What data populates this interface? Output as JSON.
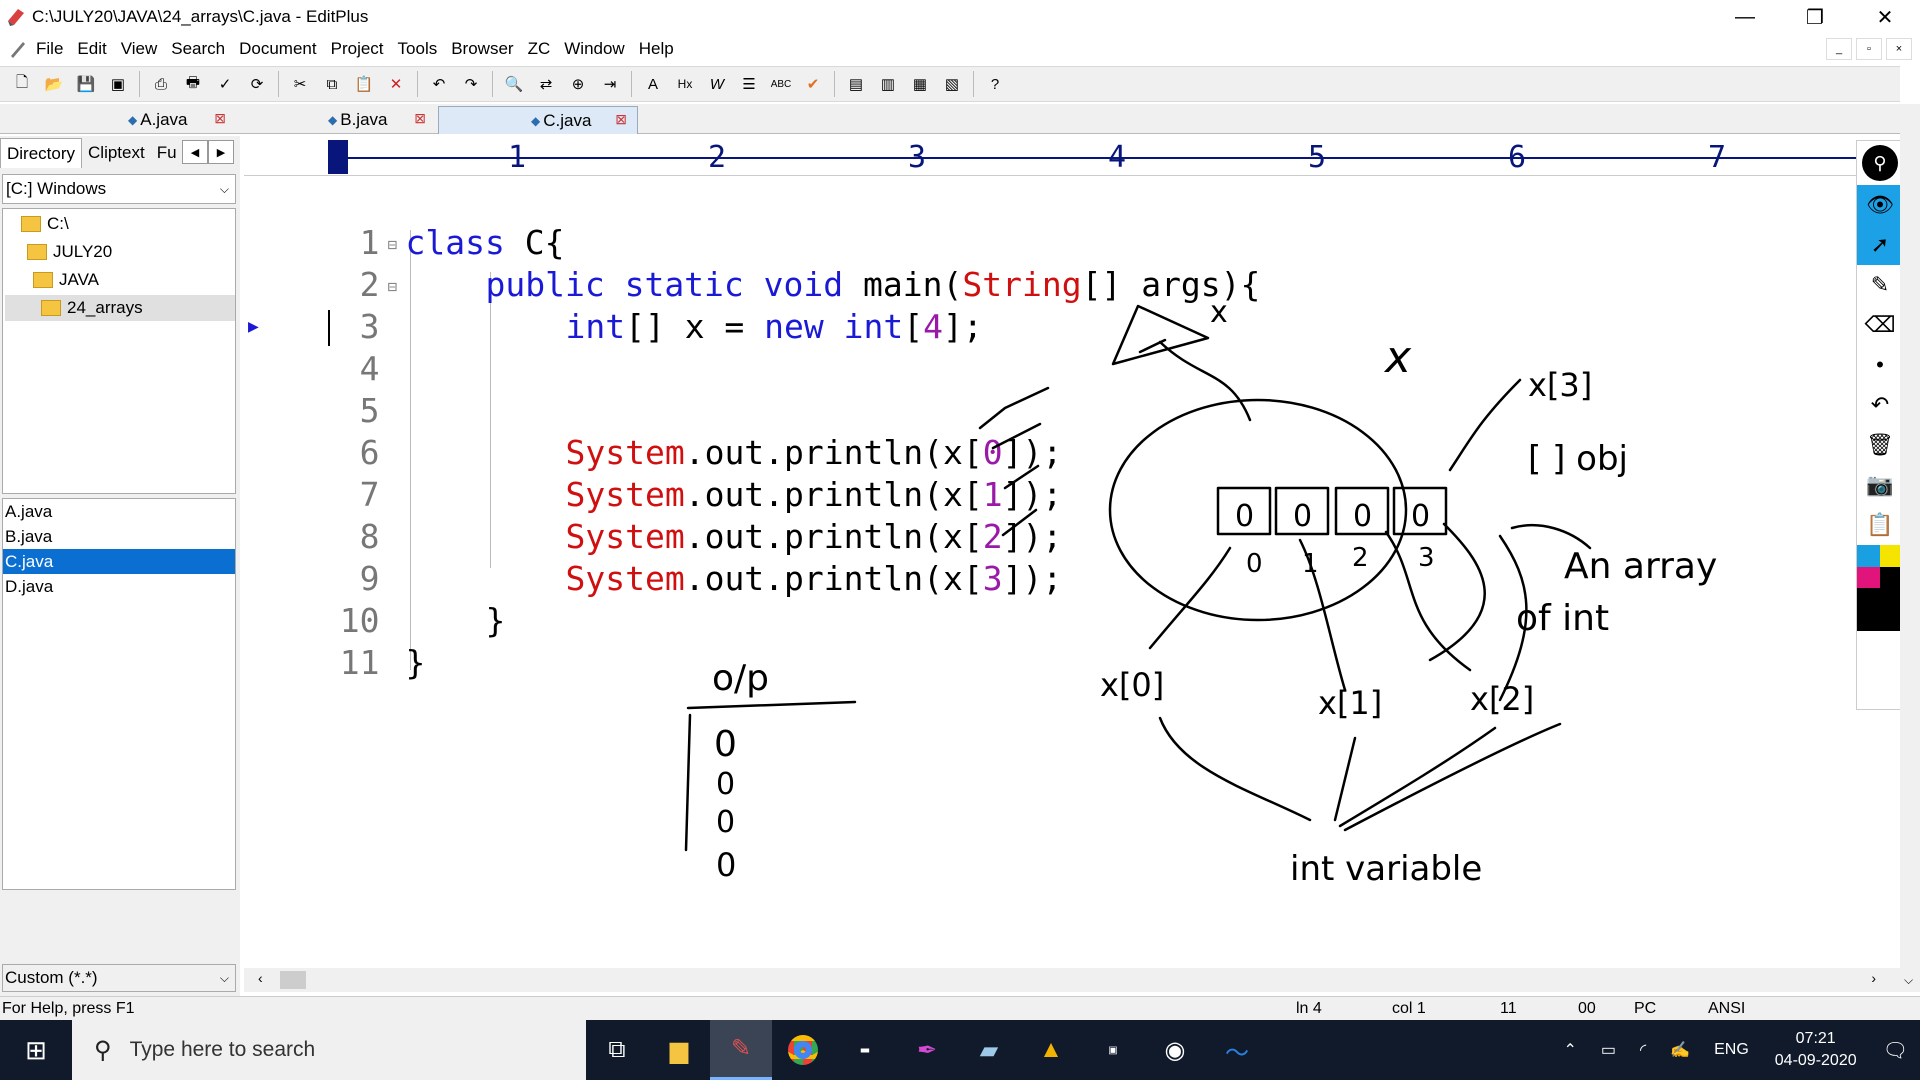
{
  "window": {
    "title": "C:\\JULY20\\JAVA\\24_arrays\\C.java - EditPlus",
    "controls": [
      "—",
      "❐",
      "✕"
    ]
  },
  "menu": {
    "items": [
      "File",
      "Edit",
      "View",
      "Search",
      "Document",
      "Project",
      "Tools",
      "Browser",
      "ZC",
      "Window",
      "Help"
    ],
    "mdi_controls": [
      "_",
      "▫",
      "×"
    ]
  },
  "tabs": [
    {
      "label": "A.java"
    },
    {
      "label": "B.java"
    },
    {
      "label": "C.java",
      "active": true
    }
  ],
  "left_panel": {
    "tabs": [
      "Directory",
      "Cliptext",
      "Fu"
    ],
    "drive": "[C:] Windows",
    "tree": [
      "C:\\",
      "JULY20",
      "JAVA",
      "24_arrays"
    ],
    "files": [
      "A.java",
      "B.java",
      "C.java",
      "D.java"
    ],
    "selected_file": "C.java",
    "filter": "Custom (*.*)"
  },
  "ruler": {
    "marks": [
      "1",
      "2",
      "3",
      "4",
      "5",
      "6",
      "7"
    ]
  },
  "code": {
    "line_numbers": [
      "1",
      "2",
      "3",
      "4",
      "5",
      "6",
      "7",
      "8",
      "9",
      "10",
      "11"
    ],
    "line1": {
      "kw": "class",
      "rest": " C{"
    },
    "line2": {
      "kw1": "public",
      "kw2": "static",
      "kw3": "void",
      "name": "main(",
      "type": "String",
      "rest": "[] args){"
    },
    "line3": {
      "kw1": "int",
      "rest1": "[] x = ",
      "kw2": "new",
      "kw3": "int",
      "open": "[",
      "num": "4",
      "close": "];"
    },
    "println": [
      {
        "sys": "System",
        "mid": ".out.println(x[",
        "idx": "0",
        "end": "]);"
      },
      {
        "sys": "System",
        "mid": ".out.println(x[",
        "idx": "1",
        "end": "]);"
      },
      {
        "sys": "System",
        "mid": ".out.println(x[",
        "idx": "2",
        "end": "]);"
      },
      {
        "sys": "System",
        "mid": ".out.println(x[",
        "idx": "3",
        "end": "]);"
      }
    ],
    "line10": "}",
    "line11": "}"
  },
  "annotations": {
    "op_label": "o/p",
    "op_values": [
      "0",
      "0",
      "0",
      "0"
    ],
    "x_top": "x",
    "x_big": "x",
    "x3": "x[3]",
    "obj": "[ ] obj",
    "array_cells": [
      "0",
      "0",
      "0",
      "0"
    ],
    "indexes": [
      "0",
      "1",
      "2",
      "3"
    ],
    "array_label_line1": "An array",
    "array_label_line2": "of int",
    "x0": "x[0]",
    "x1": "x[1]",
    "x2": "x[2]",
    "int_variable": "int variable"
  },
  "status": {
    "help": "For Help, press F1",
    "ln": "ln 4",
    "col": "col 1",
    "lines": "11",
    "code": "00",
    "mode": "PC",
    "encoding": "ANSI"
  },
  "taskbar": {
    "search_placeholder": "Type here to search",
    "language": "ENG",
    "time": "07:21",
    "date": "04-09-2020"
  },
  "colors": {
    "keyword": "#1a1ad6",
    "string_class": "#d01010",
    "number": "#9a1aa8",
    "selection": "#0b6fd1",
    "pen_active": "#1da1e6"
  }
}
